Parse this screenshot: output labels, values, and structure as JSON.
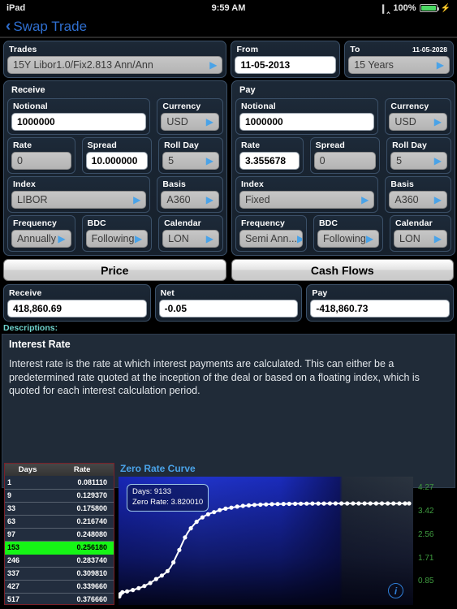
{
  "status_bar": {
    "device": "iPad",
    "time": "9:59 AM",
    "battery_percent": "100%",
    "bluetooth_icon": "bluetooth-icon",
    "battery_icon": "battery-icon",
    "charging_icon": "charging-bolt-icon"
  },
  "nav": {
    "back_label": "Swap Trade",
    "back_icon": "chevron-left-icon"
  },
  "top": {
    "trades": {
      "label": "Trades",
      "value": "15Y Libor1.0/Fix2.813 Ann/Ann"
    },
    "from": {
      "label": "From",
      "value": "11-05-2013"
    },
    "to": {
      "label": "To",
      "value": "15 Years",
      "date": "11-05-2028"
    }
  },
  "receive": {
    "title": "Receive",
    "notional": {
      "label": "Notional",
      "value": "1000000"
    },
    "currency": {
      "label": "Currency",
      "value": "USD"
    },
    "rate": {
      "label": "Rate",
      "value": "0"
    },
    "spread": {
      "label": "Spread",
      "value": "10.000000"
    },
    "roll_day": {
      "label": "Roll Day",
      "value": "5"
    },
    "index": {
      "label": "Index",
      "value": "LIBOR"
    },
    "basis": {
      "label": "Basis",
      "value": "A360"
    },
    "frequency": {
      "label": "Frequency",
      "value": "Annually"
    },
    "bdc": {
      "label": "BDC",
      "value": "Following"
    },
    "calendar": {
      "label": "Calendar",
      "value": "LON"
    }
  },
  "pay": {
    "title": "Pay",
    "notional": {
      "label": "Notional",
      "value": "1000000"
    },
    "currency": {
      "label": "Currency",
      "value": "USD"
    },
    "rate": {
      "label": "Rate",
      "value": "3.355678"
    },
    "spread": {
      "label": "Spread",
      "value": "0"
    },
    "roll_day": {
      "label": "Roll Day",
      "value": "5"
    },
    "index": {
      "label": "Index",
      "value": "Fixed"
    },
    "basis": {
      "label": "Basis",
      "value": "A360"
    },
    "frequency": {
      "label": "Frequency",
      "value": "Semi Ann..."
    },
    "bdc": {
      "label": "BDC",
      "value": "Following"
    },
    "calendar": {
      "label": "Calendar",
      "value": "LON"
    }
  },
  "actions": {
    "price": "Price",
    "cash_flows": "Cash Flows"
  },
  "results": {
    "receive": {
      "label": "Receive",
      "value": "418,860.69"
    },
    "net": {
      "label": "Net",
      "value": "-0.05"
    },
    "pay": {
      "label": "Pay",
      "value": "-418,860.73"
    }
  },
  "descriptions": {
    "label": "Descriptions:",
    "title": "Interest Rate",
    "body": "Interest rate is the rate at which interest payments are calculated.  This can either be a predetermined rate quoted at the inception of the deal or based on a floating index, which is quoted for each interest calculation period."
  },
  "chart_data": {
    "type": "line",
    "title": "Zero Rate Curve",
    "xlabel": "Days",
    "ylabel": "Rate",
    "ylim": [
      0,
      4.7
    ],
    "yticks": [
      "0.85",
      "1.71",
      "2.56",
      "3.42",
      "4.27"
    ],
    "grid": false,
    "legend": "none",
    "annotation": {
      "days_label": "Days: 9133",
      "rate_label": "Zero Rate: 3.820010"
    },
    "x": [
      1,
      9,
      33,
      63,
      97,
      153,
      246,
      337,
      427,
      517,
      610,
      700,
      790,
      880,
      975,
      1065,
      1160,
      1250,
      1340,
      1430,
      1520,
      1615,
      1705,
      1795,
      1890,
      1980,
      2070,
      2160,
      2255,
      2345,
      2435,
      2525,
      2620,
      2710,
      2800,
      2890,
      2985,
      3075,
      3165,
      3255,
      3350,
      3440,
      3530,
      3620,
      3715,
      3805,
      3895,
      3985,
      4080,
      4170,
      4260,
      4350,
      4445,
      4535,
      4625,
      4715,
      4810,
      4900,
      4990,
      5080,
      5175,
      5265,
      5355,
      5445,
      5540,
      5630,
      5720,
      5810,
      5905,
      5995,
      6085,
      6175,
      6270,
      6360,
      6450,
      6540,
      6635,
      6725,
      6815,
      6905,
      7000,
      7090,
      7180,
      7270,
      7365,
      7455,
      7545,
      7635,
      7730,
      7820,
      7910,
      8000,
      8095,
      8185,
      8275,
      8365,
      8460,
      8550,
      8640,
      8730,
      8825,
      8915,
      9005,
      9095,
      9133
    ],
    "y": [
      0.08111,
      0.12937,
      0.1758,
      0.21674,
      0.24808,
      0.25618,
      0.28374,
      0.30981,
      0.33966,
      0.37666,
      0.41,
      0.45,
      0.5,
      0.56,
      0.62,
      0.7,
      0.78,
      0.85,
      0.92,
      1.0,
      1.1,
      1.25,
      1.45,
      1.7,
      1.95,
      2.2,
      2.45,
      2.65,
      2.82,
      2.96,
      3.08,
      3.18,
      3.26,
      3.33,
      3.38,
      3.43,
      3.47,
      3.51,
      3.55,
      3.58,
      3.61,
      3.63,
      3.65,
      3.67,
      3.69,
      3.7,
      3.72,
      3.73,
      3.74,
      3.75,
      3.76,
      3.765,
      3.77,
      3.775,
      3.78,
      3.785,
      3.79,
      3.792,
      3.795,
      3.797,
      3.8,
      3.802,
      3.804,
      3.806,
      3.807,
      3.809,
      3.81,
      3.811,
      3.812,
      3.813,
      3.814,
      3.815,
      3.8155,
      3.816,
      3.8165,
      3.817,
      3.8175,
      3.818,
      3.8182,
      3.8184,
      3.8186,
      3.8188,
      3.819,
      3.8191,
      3.8192,
      3.8193,
      3.8194,
      3.8195,
      3.8196,
      3.8197,
      3.8197,
      3.8198,
      3.8198,
      3.8199,
      3.8199,
      3.82,
      3.82,
      3.82,
      3.82001,
      3.82001,
      3.82001,
      3.82001,
      3.82001,
      3.82001,
      3.82001
    ],
    "table": {
      "columns": [
        "Days",
        "Rate"
      ],
      "selected_index": 5,
      "rows": [
        {
          "days": "1",
          "rate": "0.081110"
        },
        {
          "days": "9",
          "rate": "0.129370"
        },
        {
          "days": "33",
          "rate": "0.175800"
        },
        {
          "days": "63",
          "rate": "0.216740"
        },
        {
          "days": "97",
          "rate": "0.248080"
        },
        {
          "days": "153",
          "rate": "0.256180"
        },
        {
          "days": "246",
          "rate": "0.283740"
        },
        {
          "days": "337",
          "rate": "0.309810"
        },
        {
          "days": "427",
          "rate": "0.339660"
        },
        {
          "days": "517",
          "rate": "0.376660"
        }
      ]
    }
  },
  "info_button": "info-icon"
}
